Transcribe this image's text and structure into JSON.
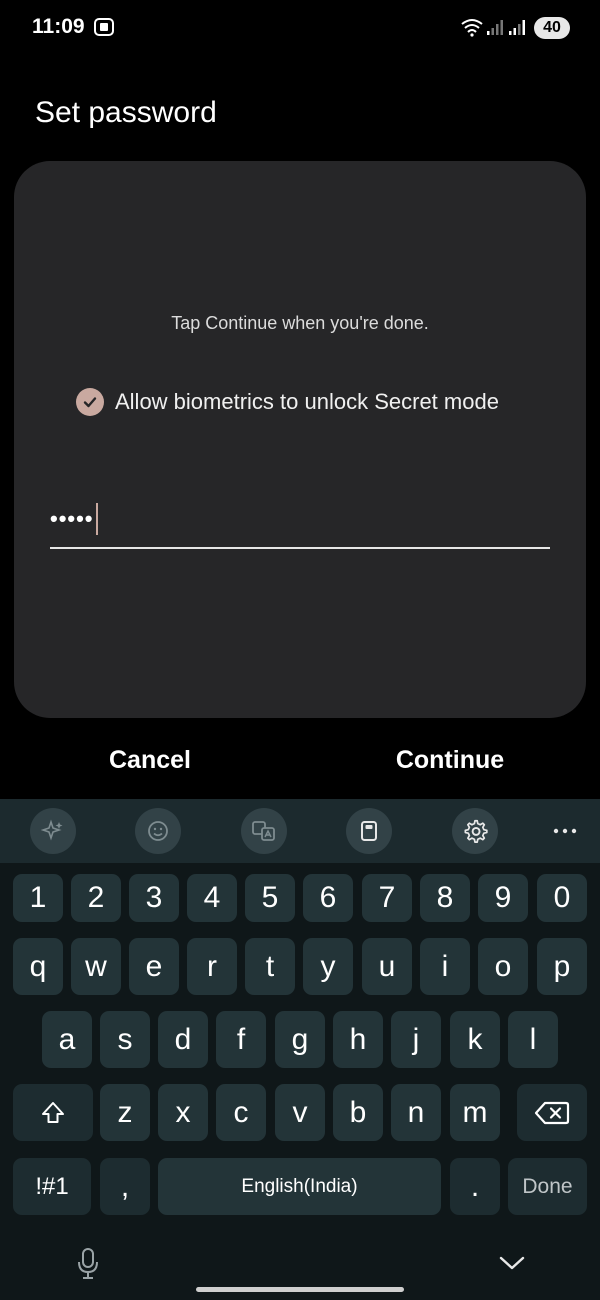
{
  "status_bar": {
    "time": "11:09",
    "battery": "40",
    "icons": [
      "screen-capture-icon",
      "wifi-icon",
      "signal-icon",
      "signal-icon"
    ]
  },
  "page": {
    "title": "Set password"
  },
  "dialog": {
    "instruction": "Tap Continue when you're done.",
    "biometric_label": "Allow biometrics to unlock Secret mode",
    "biometric_checked": true,
    "password_masked": "•••••"
  },
  "actions": {
    "cancel": "Cancel",
    "continue": "Continue"
  },
  "keyboard": {
    "toolbar_icons": [
      "ai-sparkle-icon",
      "emoji-icon",
      "translate-icon",
      "clipboard-icon",
      "settings-icon",
      "more-icon"
    ],
    "row_numbers": [
      "1",
      "2",
      "3",
      "4",
      "5",
      "6",
      "7",
      "8",
      "9",
      "0"
    ],
    "row_1": [
      "q",
      "w",
      "e",
      "r",
      "t",
      "y",
      "u",
      "i",
      "o",
      "p"
    ],
    "row_2": [
      "a",
      "s",
      "d",
      "f",
      "g",
      "h",
      "j",
      "k",
      "l"
    ],
    "row_3": [
      "z",
      "x",
      "c",
      "v",
      "b",
      "n",
      "m"
    ],
    "symbols_key": "!#1",
    "comma_key": ",",
    "space_label": "English(India)",
    "period_key": ".",
    "done_key": "Done"
  },
  "colors": {
    "accent": "#c9a9a0",
    "card_bg": "#262628",
    "key_bg": "#233438",
    "keyboard_bg": "#0f1719"
  }
}
